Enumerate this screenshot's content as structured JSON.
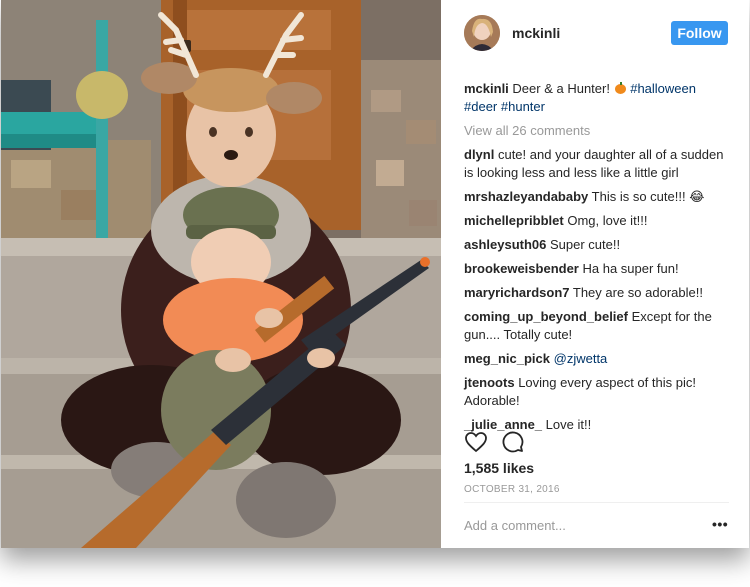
{
  "post": {
    "username": "mckinli",
    "follow_label": "Follow",
    "caption": {
      "username": "mckinli",
      "text": "Deer & a Hunter!",
      "emoji": "pumpkin-emoji",
      "hashtags": [
        "#halloween",
        "#deer",
        "#hunter"
      ]
    },
    "view_all": "View all 26 comments",
    "comments": [
      {
        "user": "dlynl",
        "text": "cute! and your daughter all of a sudden is looking less and less like a little girl"
      },
      {
        "user": "mrshazleyandababy",
        "text": "This is so cute!!! 😂"
      },
      {
        "user": "michellepribblet",
        "text": "Omg, love it!!!"
      },
      {
        "user": "ashleysuth06",
        "text": "Super cute!!"
      },
      {
        "user": "brookeweisbender",
        "text": "Ha ha super fun!"
      },
      {
        "user": "maryrichardson7",
        "text": "They are so adorable!!"
      },
      {
        "user": "coming_up_beyond_belief",
        "text": "Except for the gun.... Totally cute!"
      },
      {
        "user": "meg_nic_pick",
        "text": "@zjwetta"
      },
      {
        "user": "jtenoots",
        "text": "Loving every aspect of this pic! Adorable!"
      },
      {
        "user": "_julie_anne_",
        "text": "Love it!!"
      }
    ],
    "likes": "1,585 likes",
    "date": "OCTOBER 31, 2016",
    "add_comment_placeholder": "Add a comment...",
    "more_label": "•••",
    "colors": {
      "follow_bg": "#3897f0",
      "hashtag": "#003569",
      "muted": "#999999",
      "text": "#262626"
    },
    "icons": [
      "heart-icon",
      "comment-icon",
      "more-options-icon"
    ]
  }
}
